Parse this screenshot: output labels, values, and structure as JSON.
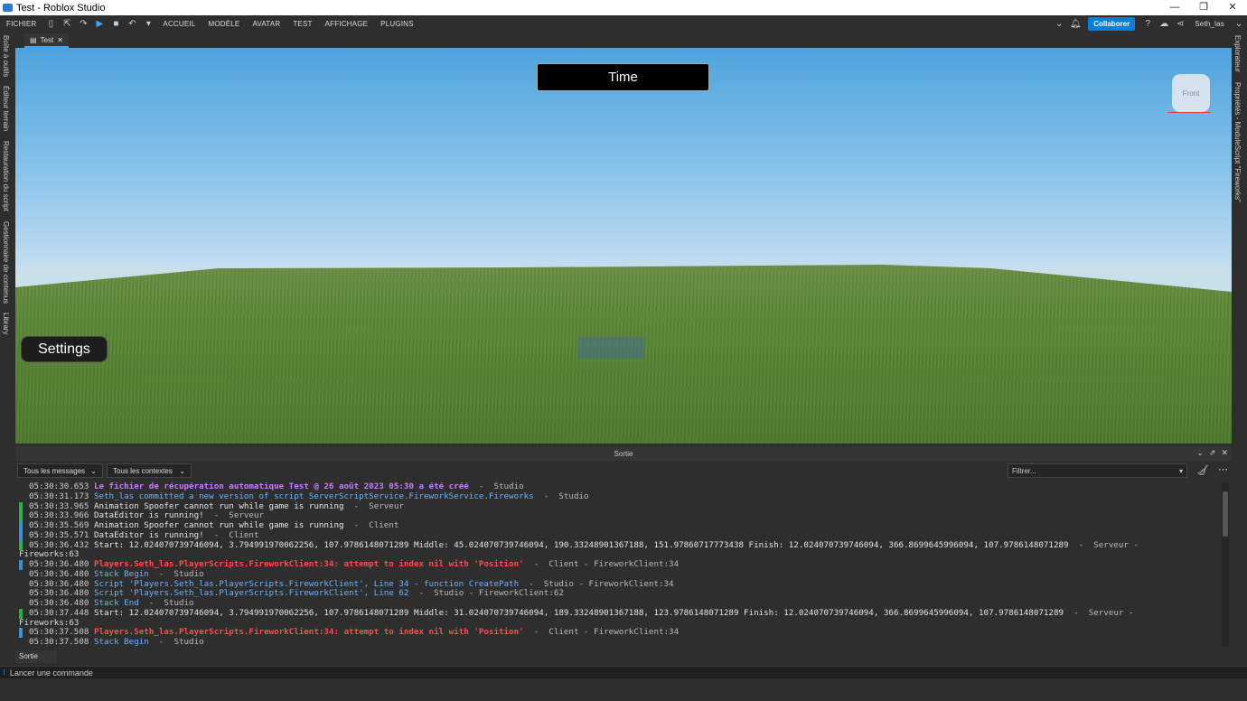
{
  "window": {
    "title": "Test - Roblox Studio",
    "controls": [
      "—",
      "❐",
      "✕"
    ]
  },
  "menu": {
    "file": "FICHIER",
    "items": [
      "ACCUEIL",
      "MODÈLE",
      "AVATAR",
      "TEST",
      "AFFICHAGE",
      "PLUGINS"
    ],
    "collab_label": "Collaborer",
    "user": "Seth_las"
  },
  "doc_tab": {
    "label": "Test",
    "close": "✕"
  },
  "left_panels": [
    "Boîte à outils",
    "Éditeur terrain",
    "Restauration du script",
    "Gestionnaire de contenus",
    "Library"
  ],
  "right_panels": [
    "Explorateur",
    "Propriétés - ModuleScript \"Fireworks\""
  ],
  "viewport": {
    "time_label": "Time",
    "settings_label": "Settings",
    "viewcube_label": "Front"
  },
  "output": {
    "title": "Sortie",
    "all_messages": "Tous les messages",
    "all_contexts": "Tous les contextes",
    "filter_placeholder": "Filtrer...",
    "lines": [
      {
        "ts": "05:30:30.653",
        "msg": "Le fichier de récupération automatique Test @ 26 août 2023 05:30 a été créé",
        "ctx": "  -  Studio",
        "style": "purple",
        "bar": ""
      },
      {
        "ts": "05:30:31.173",
        "msg": "Seth_las committed a new version of script ServerScriptService.FireworkService.Fireworks",
        "ctx": "  -  Studio",
        "style": "blue",
        "bar": ""
      },
      {
        "ts": "05:30:33.965",
        "msg": "Animation Spoofer cannot run while game is running",
        "ctx": "  -  Serveur",
        "style": "white",
        "bar": "green"
      },
      {
        "ts": "05:30:33.966",
        "msg": "DataEditor is running!",
        "ctx": "  -  Serveur",
        "style": "white",
        "bar": "green"
      },
      {
        "ts": "05:30:35.569",
        "msg": "Animation Spoofer cannot run while game is running",
        "ctx": "  -  Client",
        "style": "white",
        "bar": "blue"
      },
      {
        "ts": "05:30:35.571",
        "msg": "DataEditor is running!",
        "ctx": "  -  Client",
        "style": "white",
        "bar": "blue"
      },
      {
        "ts": "05:30:36.432",
        "msg": "Start:  12.024070739746094, 3.794991970062256, 107.9786148071289  Middle:  45.024070739746094, 190.33248901367188, 151.97860717773438  Finish:  12.024070739746094, 366.8699645996094, 107.9786148071289",
        "ctx": "  -  Serveur -",
        "style": "white",
        "bar": "green",
        "cont": "Fireworks:63"
      },
      {
        "ts": "05:30:36.480",
        "msg": "Players.Seth_las.PlayerScripts.FireworkClient:34: attempt to index nil with 'Position'",
        "ctx": "  -  Client - FireworkClient:34",
        "style": "red",
        "bar": "blue"
      },
      {
        "ts": "05:30:36.480",
        "msg": "Stack Begin",
        "ctx": "  -  Studio",
        "style": "blue",
        "bar": ""
      },
      {
        "ts": "05:30:36.480",
        "msg": "Script 'Players.Seth_las.PlayerScripts.FireworkClient', Line 34 - function CreatePath",
        "ctx": "  -  Studio - FireworkClient:34",
        "style": "blue",
        "bar": ""
      },
      {
        "ts": "05:30:36.480",
        "msg": "Script 'Players.Seth_las.PlayerScripts.FireworkClient', Line 62",
        "ctx": "  -  Studio - FireworkClient:62",
        "style": "blue",
        "bar": ""
      },
      {
        "ts": "05:30:36.480",
        "msg": "Stack End",
        "ctx": "  -  Studio",
        "style": "blue",
        "bar": ""
      },
      {
        "ts": "05:30:37.448",
        "msg": "Start:  12.024070739746094, 3.794991970062256, 107.9786148071289  Middle:  31.024070739746094, 189.33248901367188, 123.9786148071289  Finish:  12.024070739746094, 366.8699645996094, 107.9786148071289",
        "ctx": "  -  Serveur -",
        "style": "white",
        "bar": "green",
        "cont": "Fireworks:63"
      },
      {
        "ts": "05:30:37.508",
        "msg": "Players.Seth_las.PlayerScripts.FireworkClient:34: attempt to index nil with 'Position'",
        "ctx": "  -  Client - FireworkClient:34",
        "style": "red",
        "bar": "blue"
      },
      {
        "ts": "05:30:37.508",
        "msg": "Stack Begin",
        "ctx": "  -  Studio",
        "style": "blue",
        "bar": ""
      }
    ]
  },
  "bottom_tab": "Sortie",
  "command_bar": {
    "placeholder": "Lancer une commande"
  }
}
